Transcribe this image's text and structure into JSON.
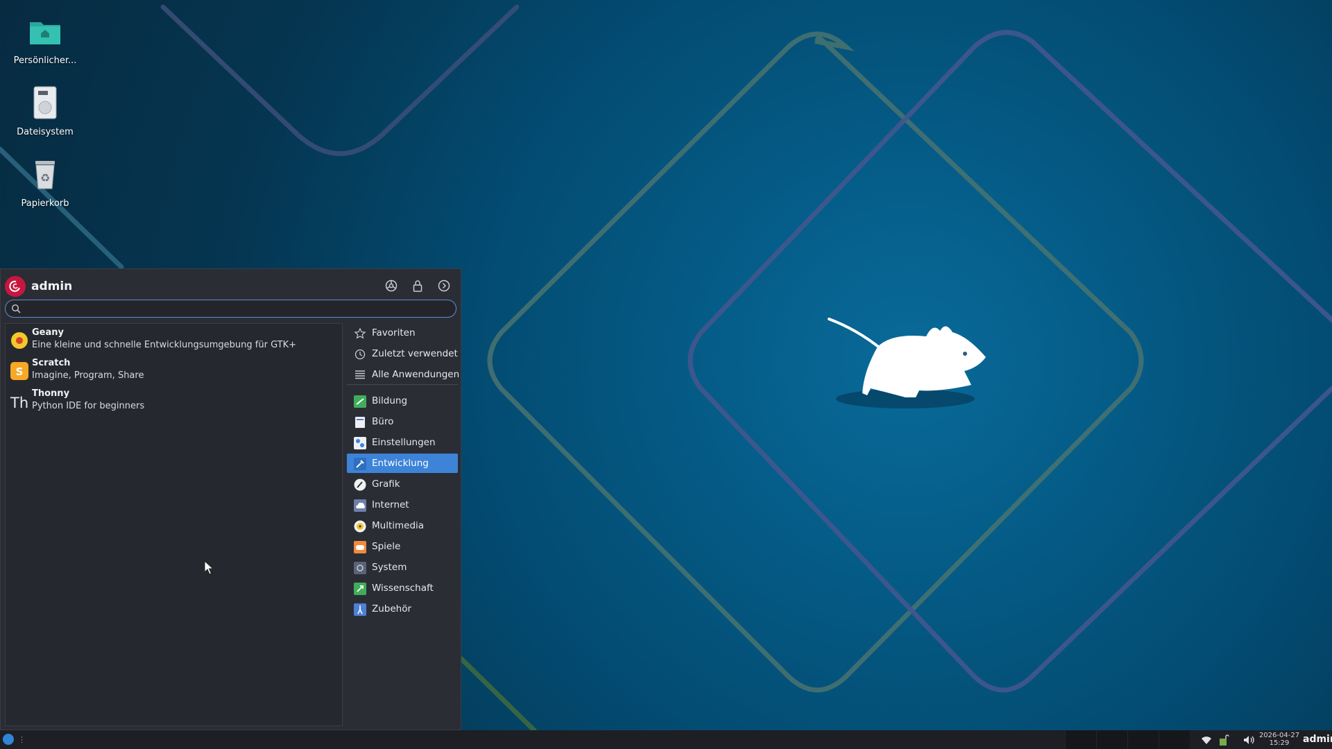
{
  "desktop": {
    "icons": [
      {
        "label": "Persönlicher...",
        "icon": "home-folder-icon"
      },
      {
        "label": "Dateisystem",
        "icon": "drive-icon"
      },
      {
        "label": "Papierkorb",
        "icon": "trash-icon"
      }
    ]
  },
  "menu": {
    "username": "admin",
    "header_actions": [
      "settings-icon",
      "lock-icon",
      "logout-icon"
    ],
    "search": {
      "value": "",
      "placeholder": ""
    },
    "apps": [
      {
        "name": "Geany",
        "description": "Eine kleine und schnelle Entwicklungsumgebung für GTK+",
        "icon": "geany-icon"
      },
      {
        "name": "Scratch",
        "description": "Imagine, Program, Share",
        "icon": "scratch-icon"
      },
      {
        "name": "Thonny",
        "description": "Python IDE for beginners",
        "icon": "thonny-icon"
      }
    ],
    "shortcuts": [
      {
        "label": "Favoriten",
        "icon": "star-icon"
      },
      {
        "label": "Zuletzt verwendet",
        "icon": "clock-icon"
      },
      {
        "label": "Alle Anwendungen",
        "icon": "list-icon"
      }
    ],
    "categories": [
      {
        "label": "Bildung",
        "icon": "education-icon"
      },
      {
        "label": "Büro",
        "icon": "office-icon"
      },
      {
        "label": "Einstellungen",
        "icon": "settings-category-icon"
      },
      {
        "label": "Entwicklung",
        "icon": "development-icon",
        "selected": true
      },
      {
        "label": "Grafik",
        "icon": "graphics-icon"
      },
      {
        "label": "Internet",
        "icon": "internet-icon"
      },
      {
        "label": "Multimedia",
        "icon": "multimedia-icon"
      },
      {
        "label": "Spiele",
        "icon": "games-icon"
      },
      {
        "label": "System",
        "icon": "system-icon"
      },
      {
        "label": "Wissenschaft",
        "icon": "science-icon"
      },
      {
        "label": "Zubehör",
        "icon": "accessories-icon"
      }
    ]
  },
  "taskbar": {
    "clock_date": "2026-04-27",
    "clock_time": "15:29",
    "user": "admin",
    "tray": [
      "wifi-icon",
      "battery-icon",
      "volume-icon"
    ]
  },
  "colors": {
    "accent": "#3d83d8",
    "menu_bg": "#2b2d35",
    "debian_red": "#c7163f"
  }
}
